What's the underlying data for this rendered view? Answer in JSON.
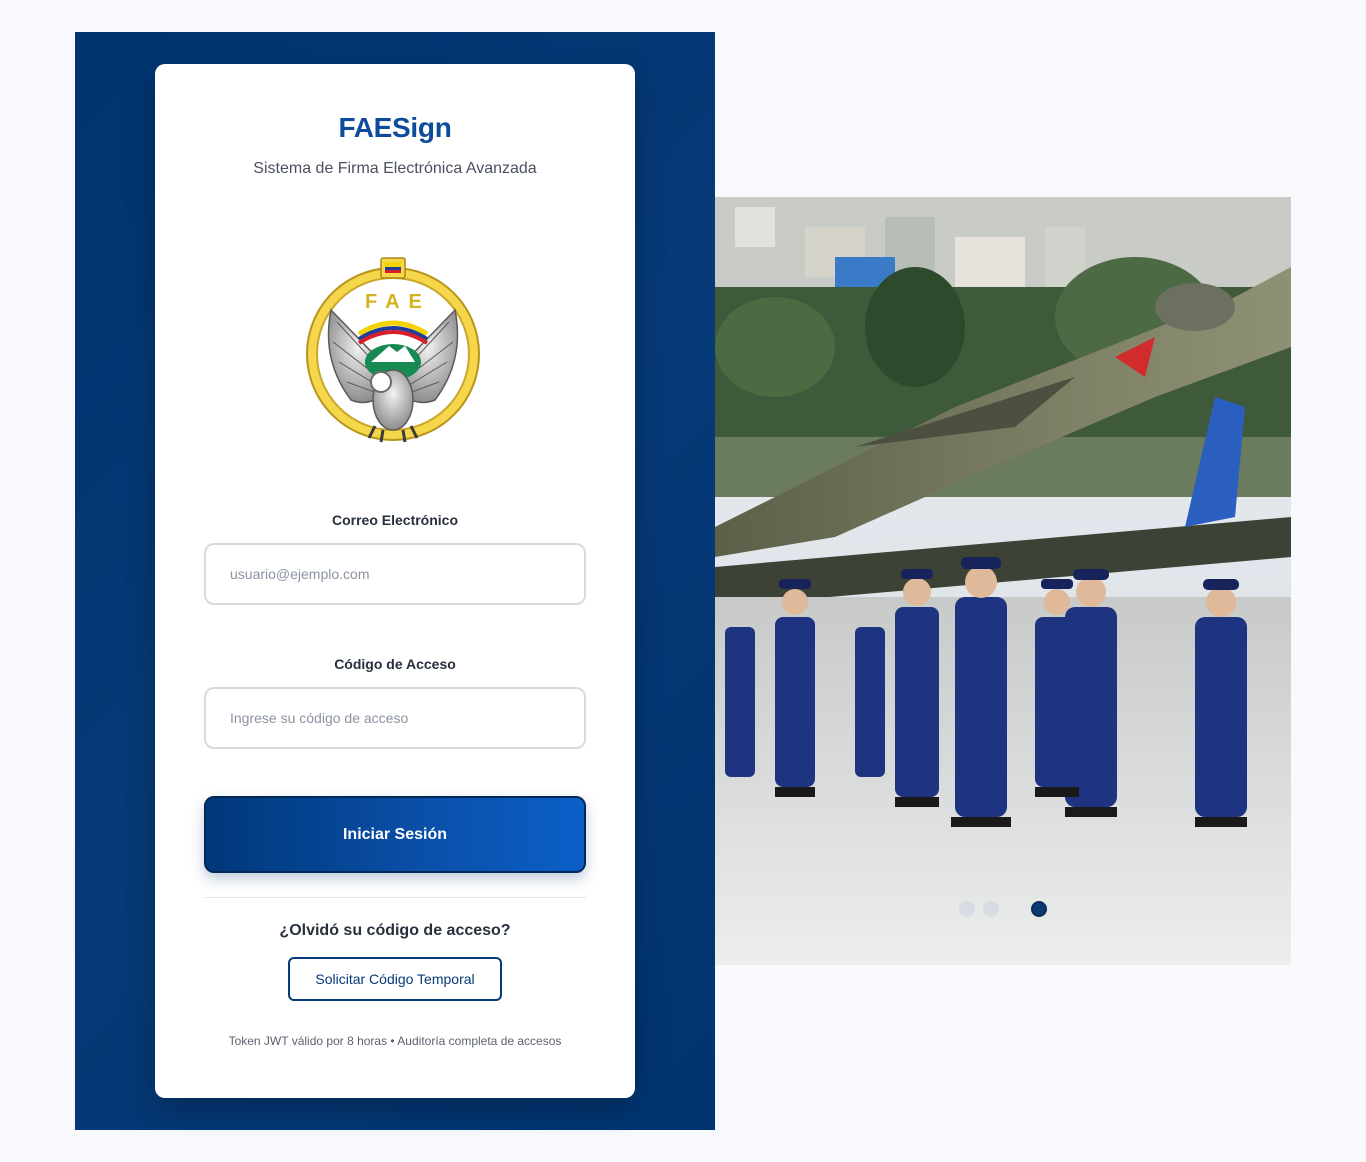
{
  "brand": {
    "title": "FAESign",
    "subtitle": "Sistema de Firma Electrónica Avanzada",
    "logo_text": "FAE"
  },
  "login_form": {
    "email_label": "Correo Electrónico",
    "email_placeholder": "usuario@ejemplo.com",
    "email_value": "",
    "code_label": "Código de Acceso",
    "code_placeholder": "Ingrese su código de acceso",
    "code_value": "",
    "submit_label": "Iniciar Sesión"
  },
  "recovery": {
    "question": "¿Olvidó su código de acceso?",
    "button_label": "Solicitar Código Temporal"
  },
  "footer_note": "Token JWT válido por 8 horas • Auditoría completa de accesos",
  "carousel": {
    "slide_count": 3,
    "active_index": 2,
    "image_icon": "military-parade-photo"
  },
  "colors": {
    "brand_dark": "#003470",
    "brand_title": "#0d4c9c",
    "button_gradient_start": "#003779",
    "button_gradient_end": "#0b5fc8"
  }
}
